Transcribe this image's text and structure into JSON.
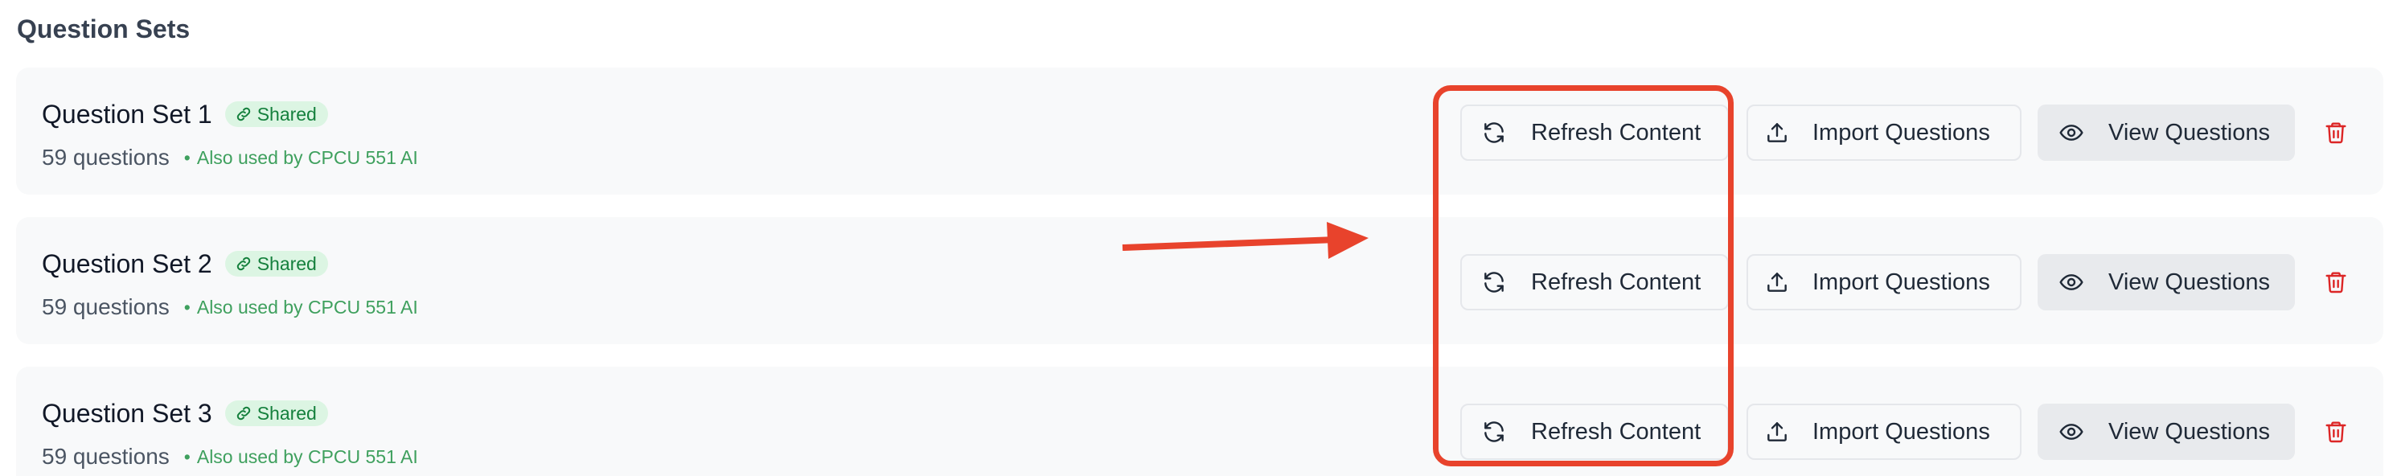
{
  "section": {
    "title": "Question Sets"
  },
  "question_sets": [
    {
      "name": "Question Set 1",
      "badge": "Shared",
      "count": "59 questions",
      "also_used_dot": "•",
      "also_used": "Also used by CPCU 551 AI"
    },
    {
      "name": "Question Set 2",
      "badge": "Shared",
      "count": "59 questions",
      "also_used_dot": "•",
      "also_used": "Also used by CPCU 551 AI"
    },
    {
      "name": "Question Set 3",
      "badge": "Shared",
      "count": "59 questions",
      "also_used_dot": "•",
      "also_used": "Also used by CPCU 551 AI"
    }
  ],
  "actions": {
    "refresh_label": "Refresh Content",
    "import_label": "Import Questions",
    "view_label": "View Questions"
  },
  "icons": {
    "refresh": "refresh-icon",
    "upload": "upload-icon",
    "eye": "eye-icon",
    "trash": "trash-icon",
    "link": "link-icon"
  },
  "colors": {
    "annotation": "#e8432c",
    "delete": "#dc2626",
    "badge_bg": "#dcf5e3",
    "badge_text": "#15803d",
    "also_used_text": "#3fa05e"
  }
}
